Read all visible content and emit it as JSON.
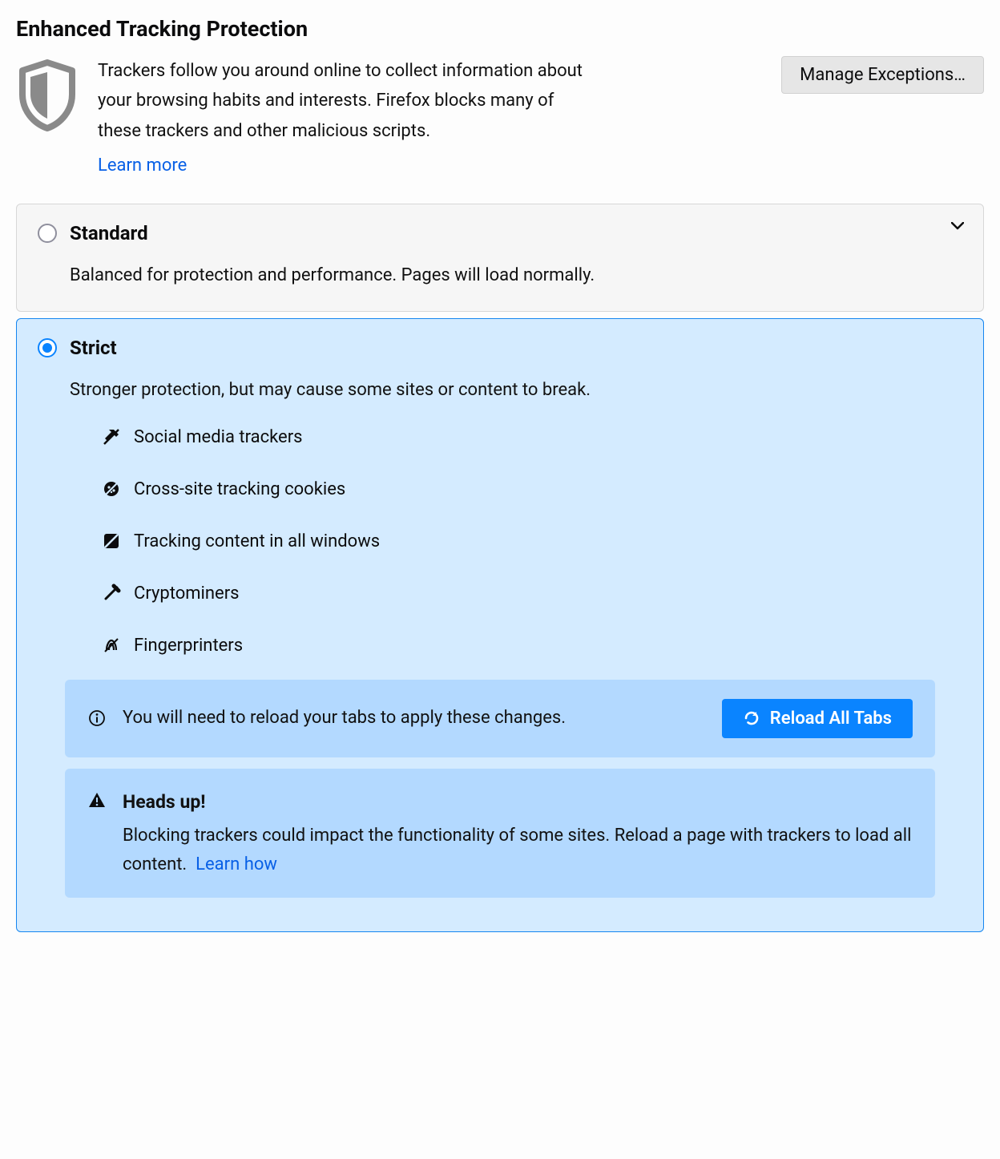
{
  "title": "Enhanced Tracking Protection",
  "description": "Trackers follow you around online to collect information about your browsing habits and interests. Firefox blocks many of these trackers and other malicious scripts.",
  "learn_more": "Learn more",
  "manage_exceptions": "Manage Exceptions…",
  "standard": {
    "title": "Standard",
    "desc": "Balanced for protection and performance. Pages will load normally."
  },
  "strict": {
    "title": "Strict",
    "desc": "Stronger protection, but may cause some sites or content to break.",
    "features": {
      "social": "Social media trackers",
      "cookies": "Cross-site tracking cookies",
      "content": "Tracking content in all windows",
      "crypto": "Cryptominers",
      "fingerprint": "Fingerprinters"
    }
  },
  "reload_notice": "You will need to reload your tabs to apply these changes.",
  "reload_button": "Reload All Tabs",
  "heads_up": {
    "title": "Heads up!",
    "body": "Blocking trackers could impact the functionality of some sites. Reload a page with trackers to load all content.",
    "learn_how": "Learn how"
  }
}
